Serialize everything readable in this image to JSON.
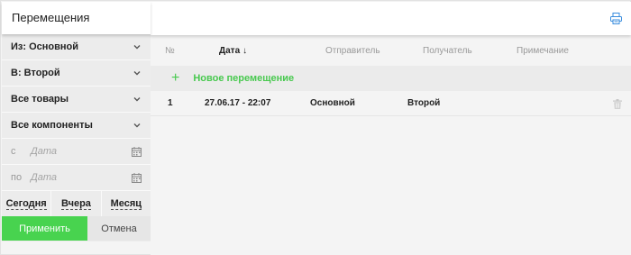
{
  "sidebar": {
    "title": "Перемещения",
    "filters": [
      {
        "label": "Из: Основной",
        "icon": "chevron-down-icon"
      },
      {
        "label": "В: Второй",
        "icon": "chevron-down-icon"
      },
      {
        "label": "Все товары",
        "icon": "chevron-down-icon"
      },
      {
        "label": "Все компоненты",
        "icon": "chevron-down-icon"
      }
    ],
    "date_from": {
      "prefix": "с",
      "placeholder": "Дата",
      "icon": "calendar-icon"
    },
    "date_to": {
      "prefix": "по",
      "placeholder": "Дата",
      "icon": "calendar-icon"
    },
    "quick": [
      "Сегодня",
      "Вчера",
      "Месяц"
    ],
    "apply_label": "Применить",
    "cancel_label": "Отмена"
  },
  "toolbar": {
    "print_icon": "print-icon"
  },
  "table": {
    "columns": {
      "num": "№",
      "date": "Дата",
      "date_sort": "↓",
      "from": "Отправитель",
      "to": "Получатель",
      "note": "Примечание"
    },
    "new_label": "Новое перемещение",
    "rows": [
      {
        "num": "1",
        "date": "27.06.17 - 22:07",
        "from": "Основной",
        "to": "Второй",
        "note": ""
      }
    ]
  },
  "colors": {
    "accent": "#48d34f",
    "link": "#48c94f",
    "print": "#3a8dde"
  }
}
